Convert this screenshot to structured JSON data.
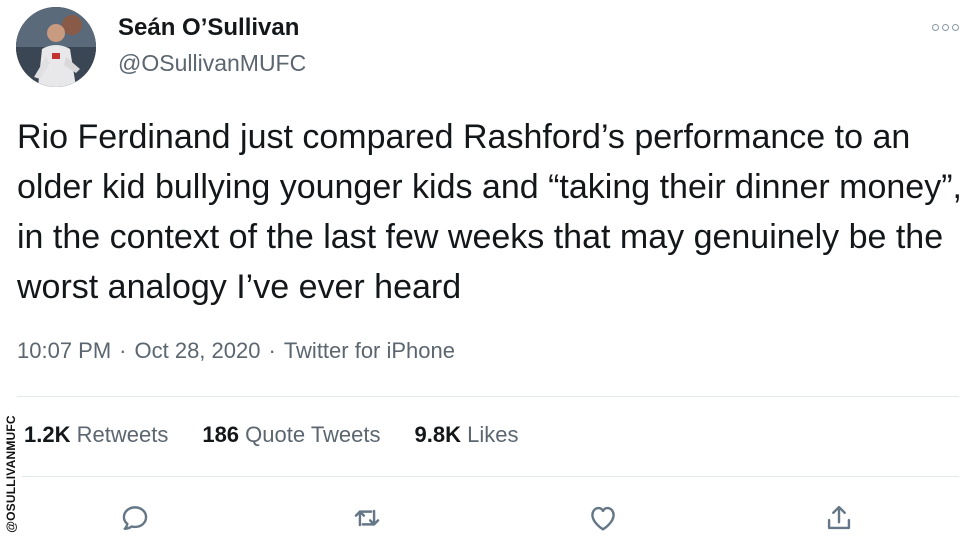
{
  "user": {
    "display_name": "Seán O’Sullivan",
    "handle": "@OSullivanMUFC"
  },
  "tweet": {
    "text": "Rio Ferdinand just compared Rashford’s performance to an older kid bullying younger kids and “taking their dinner money”, in the context of the last few weeks that may genuinely be the worst analogy I’ve ever heard",
    "time": "10:07 PM",
    "date": "Oct 28, 2020",
    "source": "Twitter for iPhone",
    "separator": "·"
  },
  "stats": {
    "retweets_count": "1.2K",
    "retweets_label": "Retweets",
    "quotes_count": "186",
    "quotes_label": "Quote Tweets",
    "likes_count": "9.8K",
    "likes_label": "Likes"
  },
  "watermark": {
    "text": "@OSULLIVANMUFC"
  },
  "icons": {
    "more": "more-options-icon",
    "reply": "reply-icon",
    "retweet": "retweet-icon",
    "like": "like-icon",
    "share": "share-icon"
  },
  "colors": {
    "text_primary": "#14171a",
    "text_secondary": "#5b6670",
    "icon": "#657786",
    "divider": "#e1e8ed"
  }
}
